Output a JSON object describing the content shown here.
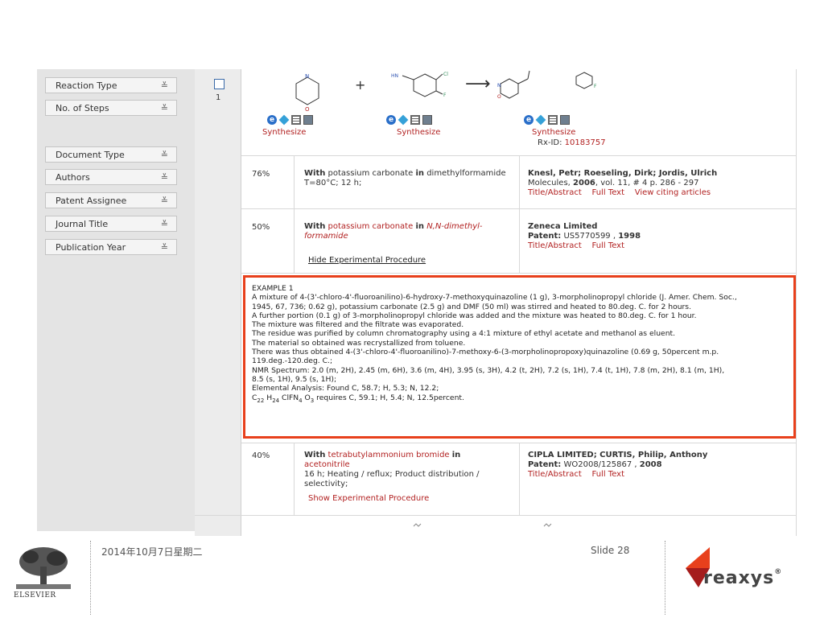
{
  "filters": [
    {
      "label": "Reaction Type"
    },
    {
      "label": "No. of Steps"
    },
    {
      "label": "Document Type"
    },
    {
      "label": "Authors"
    },
    {
      "label": "Patent Assignee"
    },
    {
      "label": "Journal Title"
    },
    {
      "label": "Publication Year"
    }
  ],
  "filter_chevron": "≚",
  "row": {
    "number": "1"
  },
  "reaction": {
    "plus": "+",
    "arrow": "⟶",
    "synthesize": "Synthesize",
    "rx_id_label": "Rx-ID: ",
    "rx_id": "10183757"
  },
  "results": [
    {
      "yield": "76%",
      "with": "With",
      "reagent": "potassium carbonate",
      "in": "in",
      "solvent": "dimethylformamide",
      "conditions": "T=80°C; 12 h;",
      "authors": "Knesl, Petr; Roeseling, Dirk; Jordis, Ulrich",
      "journal": "Molecules,",
      "year": "2006",
      "volume": ", vol. 11, # 4  p. 286 - 297",
      "links": [
        "Title/Abstract",
        "Full Text",
        "View citing articles"
      ]
    },
    {
      "yield": "50%",
      "with": "With",
      "reagent": "potassium carbonate",
      "in": "in",
      "solvent": "N,N-dimethyl-formamide",
      "toggle": "Hide Experimental Procedure",
      "assignee": "Zeneca Limited",
      "patent_label": "Patent:",
      "patent": "US5770599 ,",
      "year": "1998",
      "links": [
        "Title/Abstract",
        "Full Text"
      ]
    },
    {
      "yield": "40%",
      "with": "With",
      "reagent": "tetrabutylammonium bromide",
      "in": "in",
      "solvent": "acetonitrile",
      "conditions": "16 h; Heating / reflux; Product distribution / selectivity;",
      "toggle": "Show Experimental Procedure",
      "assignee": "CIPLA LIMITED; CURTIS, Philip, Anthony",
      "patent_label": "Patent:",
      "patent": "WO2008/125867 ,",
      "year": "2008",
      "links": [
        "Title/Abstract",
        "Full Text"
      ]
    }
  ],
  "experimental": {
    "lines": [
      "EXAMPLE 1",
      "A mixture of 4-(3'-chloro-4'-fluoroanilino)-6-hydroxy-7-methoxyquinazoline (1 g), 3-morpholinopropyl chloride (J. Amer. Chem. Soc.,",
      "1945, 67, 736; 0.62 g), potassium carbonate (2.5 g) and DMF (50 ml) was stirred and heated to 80.deg. C. for 2 hours.",
      "A further portion (0.1 g) of 3-morpholinopropyl chloride was added and the mixture was heated to 80.deg. C. for 1 hour.",
      "The mixture was filtered and the filtrate was evaporated.",
      "The residue was purified by column chromatography using a 4:1 mixture of ethyl acetate and methanol as eluent.",
      "The material so obtained was recrystallized from toluene.",
      "There was thus obtained 4-(3'-chloro-4'-fluoroanilino)-7-methoxy-6-(3-morpholinopropoxy)quinazoline (0.69 g, 50percent m.p.",
      "119.deg.-120.deg. C.;",
      "NMR Spectrum: 2.0 (m, 2H), 2.45 (m, 6H), 3.6 (m, 4H), 3.95 (s, 3H), 4.2 (t, 2H), 7.2 (s, 1H), 7.4 (t, 1H), 7.8 (m, 2H), 8.1 (m, 1H),",
      "8.5 (s, 1H), 9.5 (s, 1H);",
      "Elemental Analysis: Found C, 58.7; H, 5.3; N, 12.2;"
    ],
    "formula": {
      "c": "C",
      "c_n": "22",
      "h": "H",
      "h_n": "24",
      "mid": "ClFN",
      "n_n": "4",
      "o": "O",
      "o_n": "3",
      "rest": " requires C, 59.1; H, 5.4; N, 12.5percent."
    }
  },
  "footer": {
    "date": "2014年10月7日星期二",
    "slide": "Slide 28",
    "brand": "reaxys",
    "registered": "®",
    "publisher": "ELSEVIER"
  },
  "colors": {
    "highlight": "#e8401c",
    "link": "#b22222",
    "panel": "#e4e4e4"
  }
}
